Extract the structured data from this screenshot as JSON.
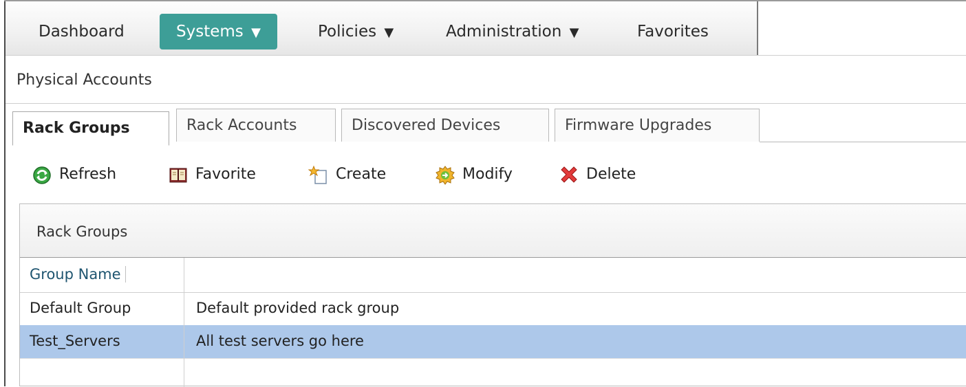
{
  "nav": {
    "items": [
      {
        "label": "Dashboard",
        "caret": ""
      },
      {
        "label": "Systems",
        "caret": "▼"
      },
      {
        "label": "Policies",
        "caret": "▼"
      },
      {
        "label": "Administration",
        "caret": "▼"
      },
      {
        "label": "Favorites",
        "caret": ""
      }
    ],
    "active_color": "#3d9e97"
  },
  "page_title": "Physical Accounts",
  "tabs": [
    {
      "label": "Rack Groups",
      "active": true
    },
    {
      "label": "Rack Accounts",
      "active": false
    },
    {
      "label": "Discovered Devices",
      "active": false
    },
    {
      "label": "Firmware Upgrades",
      "active": false
    }
  ],
  "toolbar": {
    "refresh": {
      "label": "Refresh",
      "icon": "refresh-icon"
    },
    "favorite": {
      "label": "Favorite",
      "icon": "book-icon"
    },
    "create": {
      "label": "Create",
      "icon": "create-icon"
    },
    "modify": {
      "label": "Modify",
      "icon": "modify-icon"
    },
    "delete": {
      "label": "Delete",
      "icon": "delete-icon"
    }
  },
  "panel": {
    "title": "Rack Groups",
    "columns": [
      "Group Name",
      ""
    ],
    "rows": [
      {
        "name": "Default Group",
        "description": "Default provided rack group",
        "selected": false
      },
      {
        "name": "Test_Servers",
        "description": "All test servers go here",
        "selected": true
      }
    ],
    "selected_color": "#adc8ea"
  }
}
